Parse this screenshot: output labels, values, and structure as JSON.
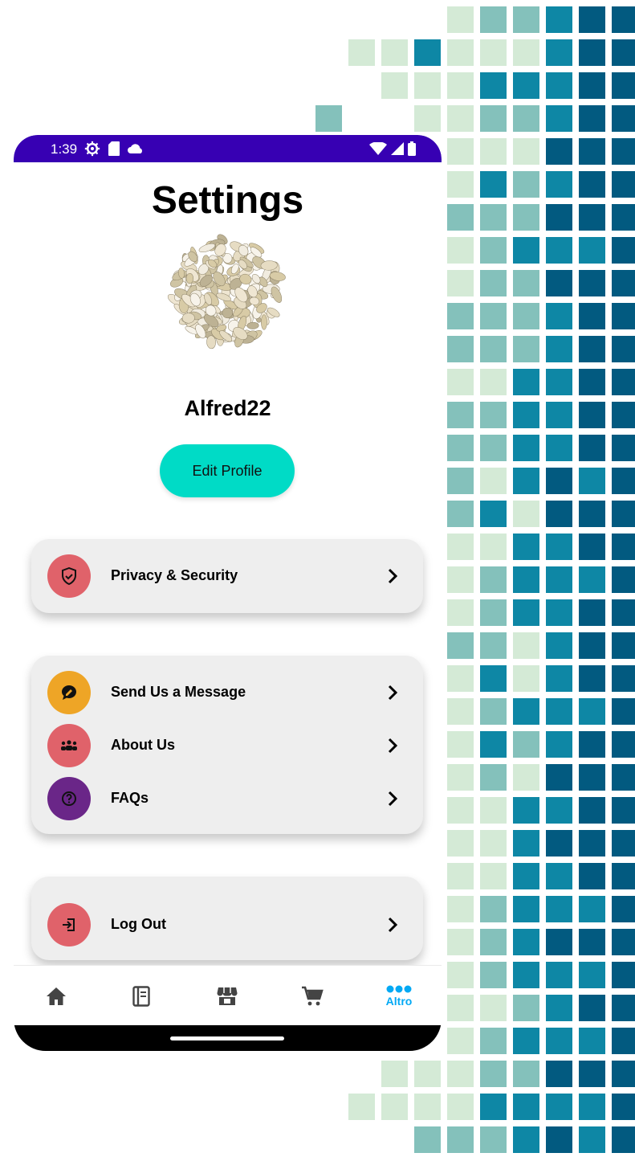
{
  "colors": {
    "status_bar": "#3700b3",
    "accent_button": "#00dbc6",
    "card_bg": "#eeeeee",
    "icon_red": "#e0626a",
    "icon_yellow": "#eea526",
    "icon_purple": "#6a2688",
    "nav_active": "#03a9f4",
    "nav_inactive": "#444444",
    "mosaic": [
      "#d4ead6",
      "#84c1bb",
      "#0e87a5",
      "#025a80"
    ]
  },
  "status_bar": {
    "time": "1:39",
    "left_icons": [
      "settings-gear-icon",
      "sd-card-icon",
      "cloud-icon"
    ],
    "right_icons": [
      "wifi-icon",
      "signal-icon",
      "battery-icon"
    ]
  },
  "header": {
    "title": "Settings"
  },
  "profile": {
    "avatar": "seeds-avatar-image",
    "username": "Alfred22",
    "edit_button": "Edit Profile"
  },
  "sections": [
    {
      "items": [
        {
          "label": "Privacy & Security",
          "icon": "shield-check-icon",
          "color": "#e0626a"
        }
      ]
    },
    {
      "items": [
        {
          "label": "Send Us a Message",
          "icon": "chat-bubble-icon",
          "color": "#eea526"
        },
        {
          "label": "About Us",
          "icon": "group-icon",
          "color": "#e0626a"
        },
        {
          "label": "FAQs",
          "icon": "question-icon",
          "color": "#6a2688"
        }
      ]
    },
    {
      "items": [
        {
          "label": "Log Out",
          "icon": "logout-icon",
          "color": "#e0626a"
        }
      ]
    }
  ],
  "bottom_nav": {
    "items": [
      {
        "icon": "home-icon",
        "label": ""
      },
      {
        "icon": "notebook-icon",
        "label": ""
      },
      {
        "icon": "store-icon",
        "label": ""
      },
      {
        "icon": "cart-icon",
        "label": ""
      },
      {
        "icon": "more-dots-icon",
        "label": "Altro",
        "active": true
      }
    ]
  }
}
